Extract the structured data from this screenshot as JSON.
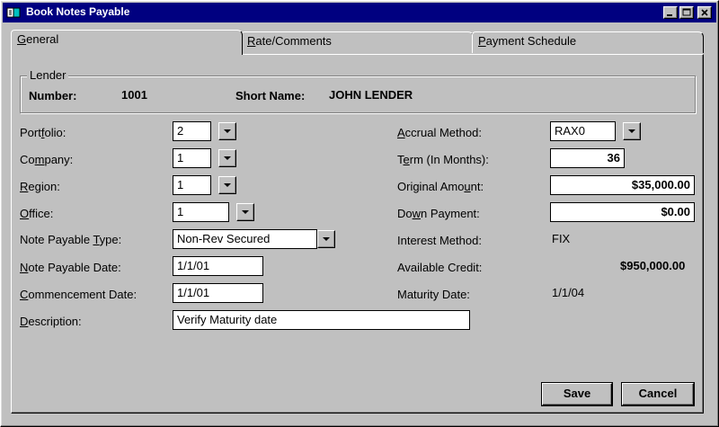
{
  "window": {
    "title": "Book Notes Payable"
  },
  "tabs": [
    {
      "label": "General",
      "hotkey": "G",
      "rest": "eneral"
    },
    {
      "label": "Rate/Comments",
      "hotkey": "R",
      "rest": "ate/Comments"
    },
    {
      "label": "Payment Schedule",
      "hotkey": "P",
      "rest": "ayment Schedule"
    }
  ],
  "lender": {
    "legend": "Lender",
    "number_label": "Number:",
    "number": "1001",
    "short_name_label": "Short Name:",
    "short_name": "JOHN LENDER"
  },
  "form": {
    "portfolio": {
      "label_pre": "Port",
      "hotkey": "f",
      "label_post": "olio:",
      "value": "2"
    },
    "company": {
      "label_pre": "Co",
      "hotkey": "m",
      "label_post": "pany:",
      "value": "1"
    },
    "region": {
      "label_pre": "",
      "hotkey": "R",
      "label_post": "egion:",
      "value": "1"
    },
    "office": {
      "label_pre": "",
      "hotkey": "O",
      "label_post": "ffice:",
      "value": "1"
    },
    "note_type": {
      "label_pre": "Note Payable ",
      "hotkey": "T",
      "label_post": "ype:",
      "value": "Non-Rev Secured"
    },
    "note_date": {
      "label_pre": "",
      "hotkey": "N",
      "label_post": "ote Payable Date:",
      "value": "1/1/01"
    },
    "commencement_date": {
      "label_pre": "",
      "hotkey": "C",
      "label_post": "ommencement Date:",
      "value": "1/1/01"
    },
    "description": {
      "label_pre": "",
      "hotkey": "D",
      "label_post": "escription:",
      "value": "Verify Maturity date"
    },
    "accrual_method": {
      "label_pre": "",
      "hotkey": "A",
      "label_post": "ccrual Method:",
      "value": "RAX0"
    },
    "term": {
      "label_pre": "T",
      "hotkey": "e",
      "label_post": "rm (In Months):",
      "value": "36"
    },
    "original_amount": {
      "label_pre": "Original Amo",
      "hotkey": "u",
      "label_post": "nt:",
      "value": "$35,000.00"
    },
    "down_payment": {
      "label_pre": "Do",
      "hotkey": "w",
      "label_post": "n Payment:",
      "value": "$0.00"
    },
    "interest_method": {
      "label": "Interest Method:",
      "value": "FIX"
    },
    "available_credit": {
      "label": "Available Credit:",
      "value": "$950,000.00"
    },
    "maturity_date": {
      "label": "Maturity Date:",
      "value": "1/1/04"
    }
  },
  "buttons": {
    "save": "Save",
    "cancel": "Cancel"
  }
}
